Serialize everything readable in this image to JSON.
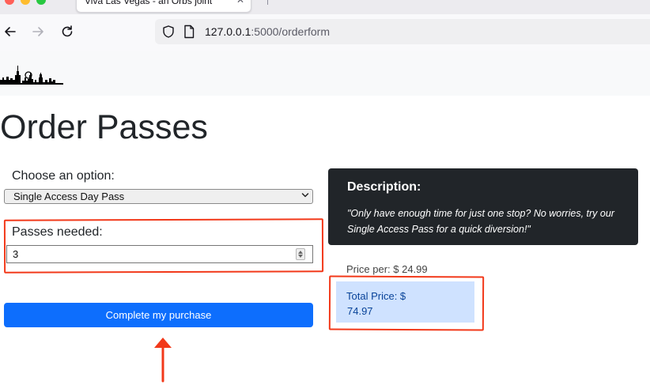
{
  "browser": {
    "tab_title": "Viva Las Vegas - an Orbs joint",
    "tab_close_icon": "close-icon",
    "url_host": "127.0.0.1",
    "url_path": ":5000/orderform",
    "nav_icons": [
      "back-arrow-icon",
      "forward-arrow-icon",
      "reload-icon",
      "shield-icon",
      "page-icon"
    ],
    "traffic_light_colors": [
      "#ff5f57",
      "#febc2e",
      "#28c840"
    ]
  },
  "header": {
    "logo": "las-vegas-skyline-logo"
  },
  "main": {
    "title": "Order Passes",
    "choose_label": "Choose an option:",
    "selected_option": "Single Access Day Pass",
    "passes_label": "Passes needed:",
    "passes_value": "3",
    "submit_label": "Complete my purchase"
  },
  "description": {
    "heading": "Description:",
    "text": "\"Only have enough time for just one stop? No worries, try our Single Access Pass for a quick diversion!\""
  },
  "pricing": {
    "price_per": "Price per: $ 24.99",
    "total_label": "Total Price: $",
    "total_value": "74.97"
  },
  "colors": {
    "primary_button": "#0d6efd",
    "description_bg": "#212529",
    "total_bg": "#cfe2ff",
    "total_text": "#084298",
    "annotation": "#f2391a"
  }
}
